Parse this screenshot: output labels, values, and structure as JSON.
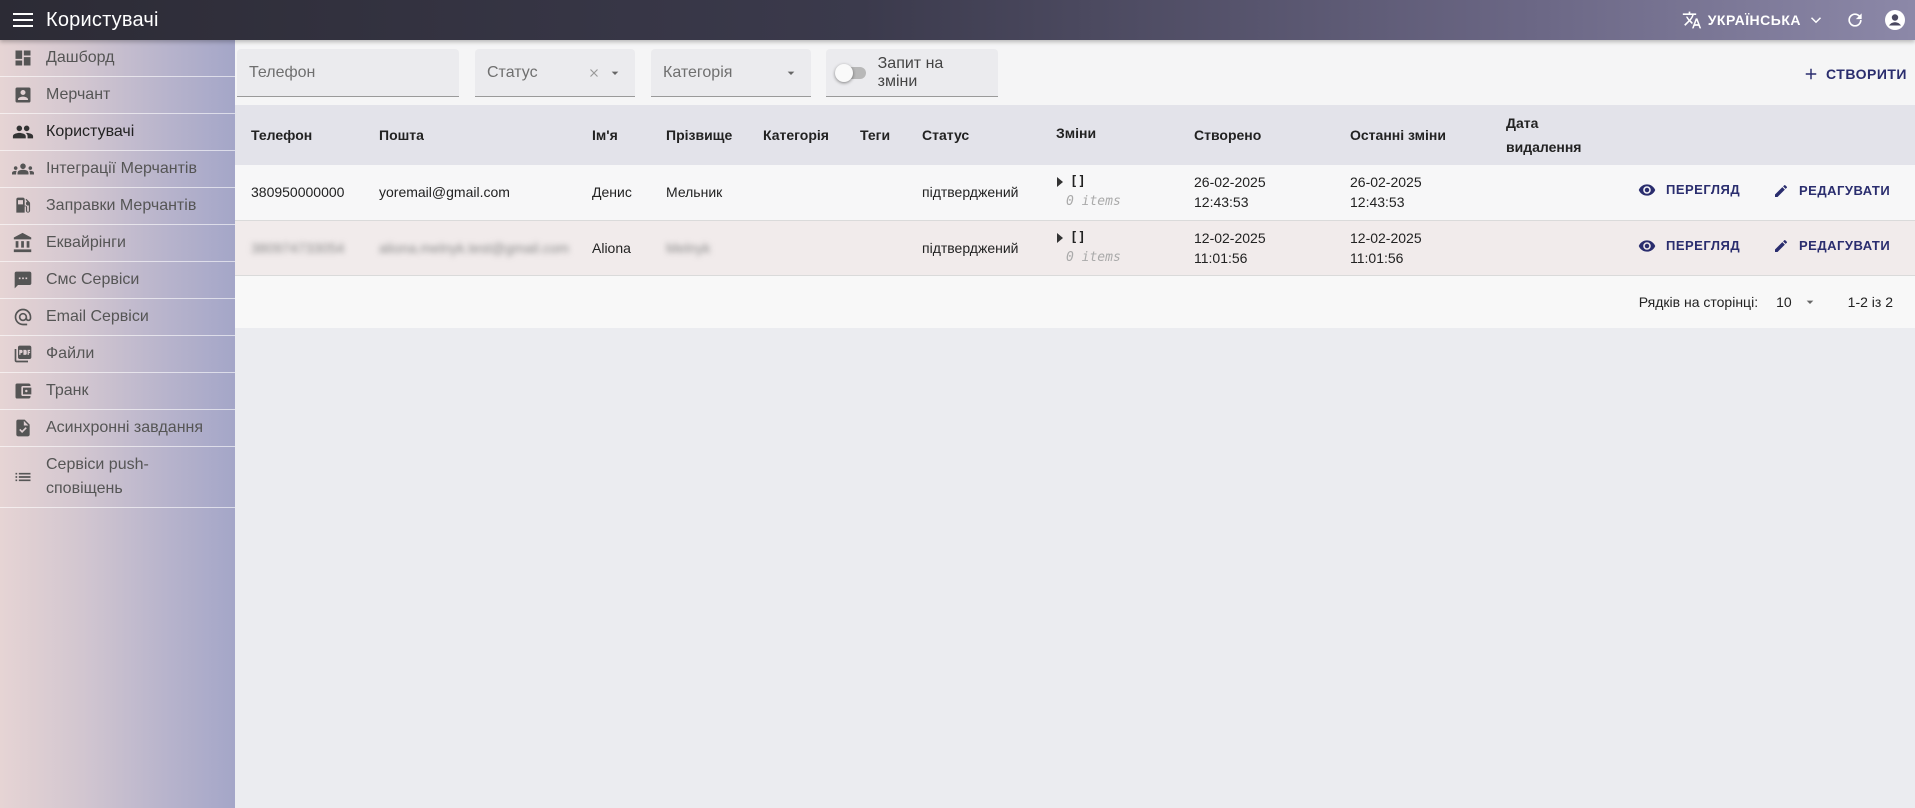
{
  "app": {
    "title": "Користувачі",
    "language": "УКРАЇНСЬКА"
  },
  "sidebar": {
    "items": [
      {
        "label": "Дашборд",
        "icon": "dashboard-icon"
      },
      {
        "label": "Мерчант",
        "icon": "merchant-icon"
      },
      {
        "label": "Користувачі",
        "icon": "people-icon"
      },
      {
        "label": "Інтеграції Мерчантів",
        "icon": "groups-icon"
      },
      {
        "label": "Заправки Мерчантів",
        "icon": "gas-station-icon"
      },
      {
        "label": "Еквайрінги",
        "icon": "bank-icon"
      },
      {
        "label": "Смс Сервіси",
        "icon": "sms-icon"
      },
      {
        "label": "Email Сервіси",
        "icon": "at-icon"
      },
      {
        "label": "Файли",
        "icon": "pdf-icon"
      },
      {
        "label": "Транк",
        "icon": "wallet-icon"
      },
      {
        "label": "Асинхронні завдання",
        "icon": "task-icon"
      },
      {
        "label": "Сервіси push-сповіщень",
        "icon": "list-icon"
      }
    ],
    "active_index": 2
  },
  "filters": {
    "phone_placeholder": "Телефон",
    "status_placeholder": "Статус",
    "category_placeholder": "Категорія",
    "change_request_label": "Запит на зміни"
  },
  "toolbar": {
    "create_label": "СТВОРИТИ"
  },
  "table": {
    "headers": {
      "phone": "Телефон",
      "email": "Пошта",
      "first_name": "Ім'я",
      "last_name": "Прізвище",
      "category": "Категорія",
      "tags": "Теги",
      "status": "Статус",
      "changes": "Зміни",
      "created": "Створено",
      "updated": "Останні зміни",
      "deleted_line1": "Дата",
      "deleted_line2": "видалення"
    },
    "rows": [
      {
        "phone": "380950000000",
        "email": "yoremail@gmail.com",
        "first_name": "Денис",
        "last_name": "Мельник",
        "category": "",
        "tags": "",
        "status": "підтверджений",
        "changes_value": "[]",
        "changes_count": "0 items",
        "created_date": "26-02-2025",
        "created_time": "12:43:53",
        "updated_date": "26-02-2025",
        "updated_time": "12:43:53",
        "view_label": "ПЕРЕГЛЯД",
        "edit_label": "РЕДАГУВАТИ"
      },
      {
        "phone": "380974733054",
        "email": "aliona.melnyk.test@gmail.com",
        "first_name": "Aliona",
        "last_name": "Melnyk",
        "category": "",
        "tags": "",
        "status": "підтверджений",
        "changes_value": "[]",
        "changes_count": "0 items",
        "created_date": "12-02-2025",
        "created_time": "11:01:56",
        "updated_date": "12-02-2025",
        "updated_time": "11:01:56",
        "view_label": "ПЕРЕГЛЯД",
        "edit_label": "РЕДАГУВАТИ"
      }
    ]
  },
  "pagination": {
    "rows_per_page_label": "Рядків на сторінці:",
    "rows_per_page_value": "10",
    "range_label": "1-2 із 2"
  },
  "colors": {
    "accent": "#2a2d6e",
    "appbar_dark": "#2c2b35",
    "appbar_light": "#8c88a8"
  }
}
